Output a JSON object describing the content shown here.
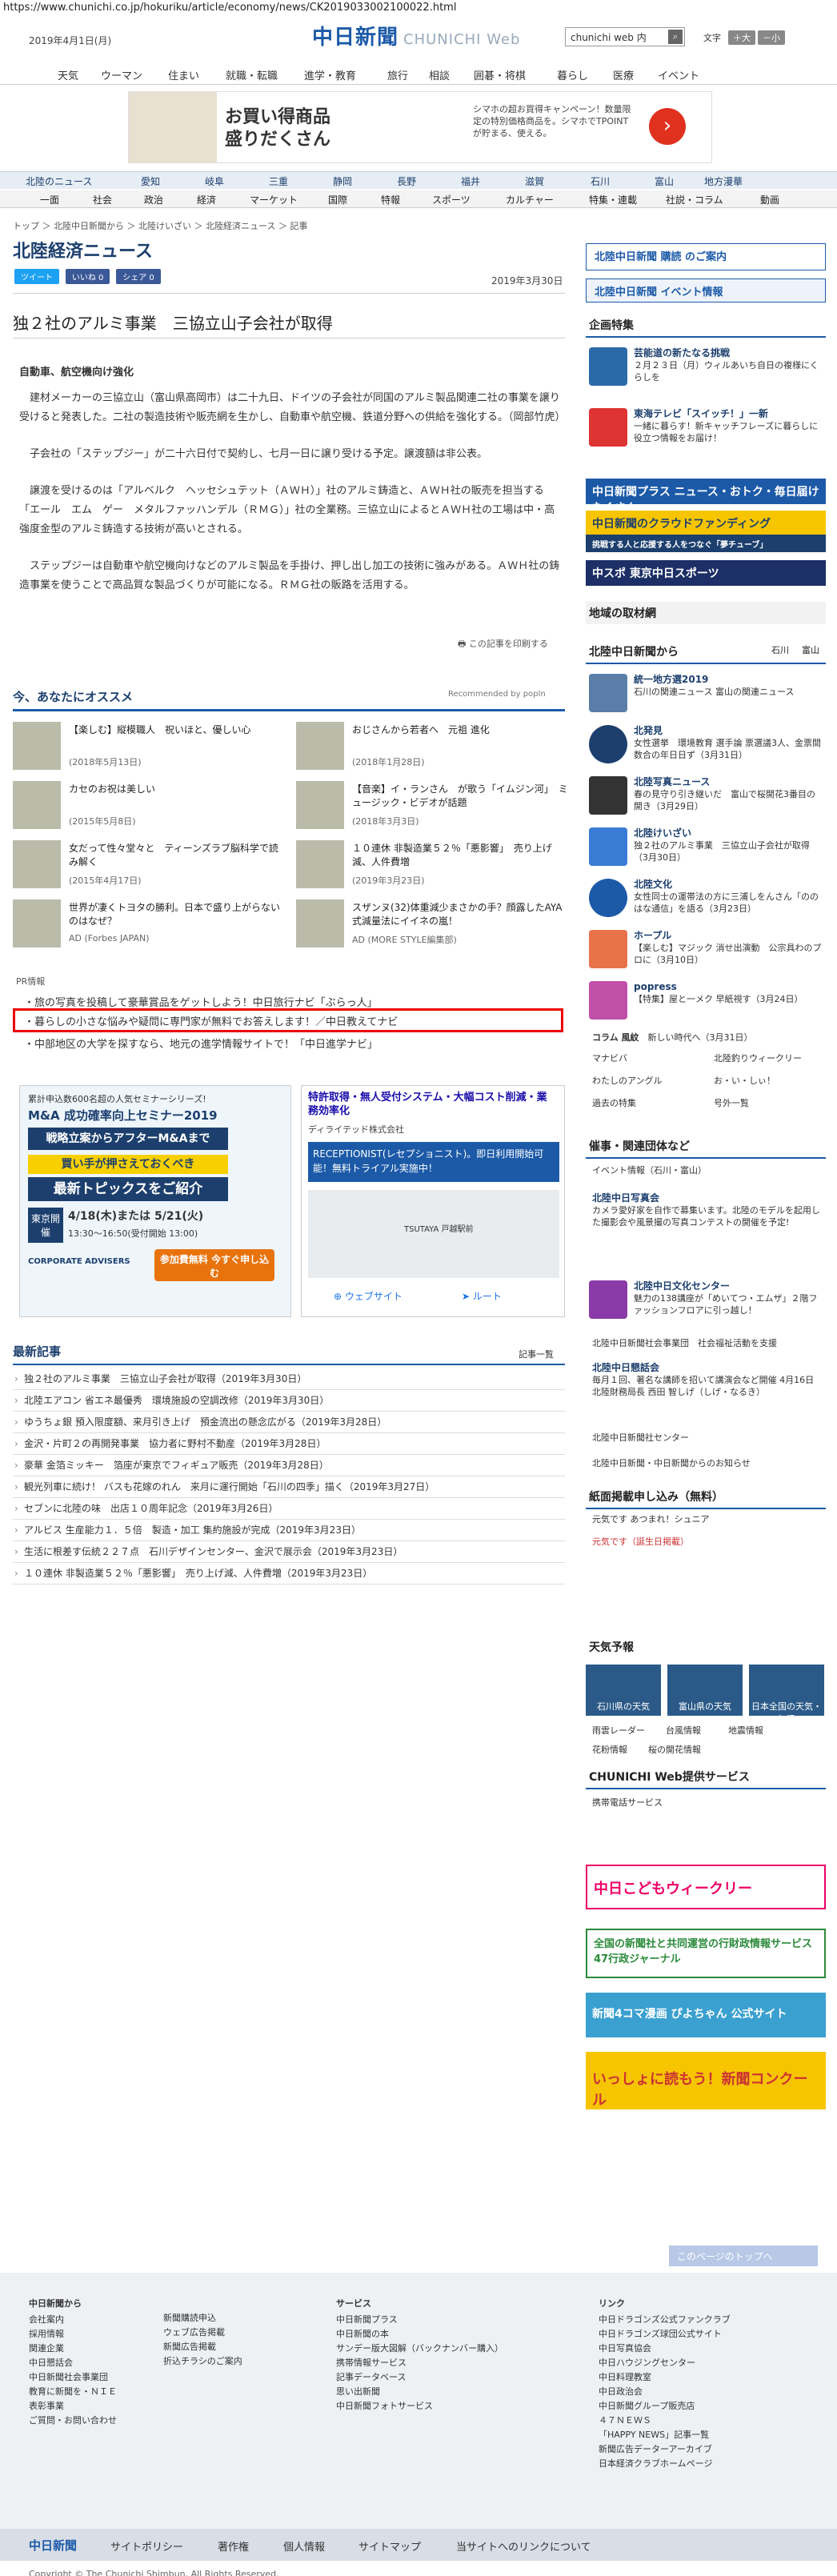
{
  "url": "https://www.chunichi.co.jp/hokuriku/article/economy/news/CK2019033002100022.html",
  "header": {
    "date": "2019年4月1日(月)",
    "logo": "中日新聞",
    "logo_web": "CHUNICHI Web",
    "search_placeholder": "chunichi web 内",
    "search_icon": "search-icon",
    "font_label": "文字",
    "font_small": "小",
    "font_plus": "＋大",
    "font_minus": "－小"
  },
  "gnav": [
    "天気",
    "ウーマン",
    "住まい",
    "就職・転職",
    "進学・教育",
    "旅行",
    "相談",
    "囲碁・将棋",
    "暮らし",
    "医療",
    "イベント"
  ],
  "banner1": {
    "title": "お買い得商品\n盛りだくさん",
    "text": "シマホの超お買得キャンペーン！数量限定の特別価格商品を。シマホでTPOINTが貯まる、使える。"
  },
  "lnav1": [
    "北陸のニュース",
    "愛知",
    "岐阜",
    "三重",
    "静岡",
    "長野",
    "福井",
    "滋賀",
    "石川",
    "富山",
    "地方漫華"
  ],
  "lnav2": [
    "一面",
    "社会",
    "政治",
    "経済",
    "マーケット",
    "国際",
    "特報",
    "スポーツ",
    "カルチャー",
    "特集・連載",
    "社説・コラム",
    "動画"
  ],
  "breadcrumb": "トップ ＞ 北陸中日新聞から ＞ 北陸けいざい ＞ 北陸経済ニュース ＞ 記事",
  "section_title": "北陸経済ニュース",
  "social": {
    "tweet": "ツイート",
    "like": "いいね 0",
    "share": "シェア 0"
  },
  "article": {
    "date": "2019年3月30日",
    "title": "独２社のアルミ事業　三協立山子会社が取得",
    "subhead": "自動車、航空機向け強化",
    "p1": "建材メーカーの三協立山（富山県高岡市）は二十九日、ドイツの子会社が同国のアルミ製品関連二社の事業を譲り受けると発表した。二社の製造技術や販売網を生かし、自動車や航空機、鉄道分野への供給を強化する。（岡部竹虎）",
    "p2": "子会社の「ステップジー」が二十六日付で契約し、七月一日に譲り受ける予定。譲渡額は非公表。",
    "p3": "譲渡を受けるのは「アルベルク　ヘッセシュテット（ＡＷＨ）」社のアルミ鋳造と、ＡＷＨ社の販売を担当する「エール　エム　ゲー　メタルファッハンデル（ＲＭＧ）」社の全業務。三協立山によるとＡＷＨ社の工場は中・高強度金型のアルミ鋳造する技術が高いとされる。",
    "p4": "ステップジーは自動車や航空機向けなどのアルミ製品を手掛け、押し出し加工の技術に強みがある。ＡＷＨ社の鋳造事業を使うことで高品質な製品づくりが可能になる。ＲＭＧ社の販路を活用する。",
    "mail": "この記事を印刷する"
  },
  "rec": {
    "title": "今、あなたにオススメ",
    "powered": "Recommended by popIn",
    "items": [
      {
        "t": "【楽しむ】縦模職人　祝いほと、優しい心",
        "d": "(2018年5月13日)"
      },
      {
        "t": "おじさんから若者へ　元祖 進化",
        "d": "(2018年1月28日)"
      },
      {
        "t": "カセのお祝は美しい",
        "d": "(2015年5月8日)"
      },
      {
        "t": "【音楽】イ・ランさん　が歌う「イムジン河」　ミュージック・ビデオが話題",
        "d": "(2018年3月3日)"
      },
      {
        "t": "女だって性々堂々と　ティーンズラブ脳科学で読み解く",
        "d": "(2015年4月17日)"
      },
      {
        "t": "１０連休 非製造業５２％「悪影響」　売り上げ減、人件費増",
        "d": "(2019年3月23日)"
      },
      {
        "t": "世界が凄くトヨタの勝利。日本で盛り上がらないのはなぜ？",
        "d": "AD (Forbes JAPAN)"
      },
      {
        "t": "スザンヌ(32)体重減少まさかの手？顔露したAYA式減量法にイイネの嵐！",
        "d": "AD (MORE STYLE編集部)"
      }
    ]
  },
  "pr": {
    "label": "PR情報",
    "links": [
      "旅の写真を投稿して豪華賞品をゲットしよう！中日旅行ナビ「ぶらっ人」",
      "暮らしの小さな悩みや疑問に専門家が無料でお答えします！／中日教えてナビ",
      "中部地区の大学を探すなら、地元の進学情報サイトで！「中日進学ナビ」"
    ]
  },
  "ad1": {
    "top": "累計申込数600名超の人気セミナーシリーズ!",
    "name": "M&A 成功確率向上セミナー2019",
    "line1": "戦略立案からアフターM&Aまで",
    "line2": "買い手が押さえておくべき",
    "line3": "最新トピックスをご紹介",
    "city": "東京開催",
    "date": "4/18(木)または 5/21(火)",
    "time": "13:30～16:50(受付開始 13:00)",
    "btn": "参加費無料 今すぐ申し込む",
    "brand": "CORPORATE ADVISERS"
  },
  "ad2": {
    "title": "特許取得・無人受付システム・大幅コスト削減・業務効率化",
    "company": "ディライテッド株式会社",
    "body": "RECEPTIONIST(レセプショニスト)。即日利用開始可能！無料トライアル実施中！",
    "web": "ウェブサイト",
    "route": "ルート",
    "map": "TSUTAYA 戸越駅前"
  },
  "latest": {
    "title": "最新記事",
    "more": "記事一覧",
    "items": [
      "独２社のアルミ事業　三協立山子会社が取得（2019年3月30日）",
      "北陸エアコン 省エネ最優秀　環境施設の空調改修（2019年3月30日）",
      "ゆうちょ銀 預入限度額、来月引き上げ　預金流出の懸念広がる（2019年3月28日）",
      "金沢・片町２の再開発事業　協力者に野村不動産（2019年3月28日）",
      "豪華 金箔ミッキー　箔座が東京でフィギュア販売（2019年3月28日）",
      "観光列車に続け！ バスも花嫁のれん　来月に運行開始「石川の四季」描く（2019年3月27日）",
      "セブンに北陸の味　出店１０周年記念（2019年3月26日）",
      "アルビス 生産能力１．５倍　製造・加工 集約施設が完成（2019年3月23日）",
      "生活に根差す伝統２２７点　石川デザインセンター、金沢で展示会（2019年3月23日）",
      "１０連休 非製造業５２％「悪影響」　売り上げ減、人件費増（2019年3月23日）"
    ]
  },
  "right": {
    "subscribe": "北陸中日新聞 購読 のご案内",
    "event": "北陸中日新聞 イベント情報",
    "kikaku": "企画特集",
    "k1": {
      "title": "芸能道の新たなる挑戦",
      "text": "２月２３日（月）ウィルあいち自日の複様にくらしを"
    },
    "k2": {
      "title": "東海テレビ「スイッチ！」一新",
      "text": "一緒に暮らす！新キャッチフレーズに暮らしに役立つ情報をお届け！"
    },
    "plus": "中日新聞プラス ニュース・おトク・毎日届けたくさん",
    "crowd": "中日新聞のクラウドファンディング",
    "crowd_sub": "挑戦する人と応援する人をつなぐ「夢チューブ」",
    "chuspo": "中スポ 東京中日スポーツ",
    "chiiki": "地域の取材網",
    "hokuriku": "北陸中日新聞から",
    "ishikawa": "石川",
    "toyama": "富山",
    "items": [
      {
        "title": "統一地方選2019",
        "text": "石川の関連ニュース 富山の関連ニュース"
      },
      {
        "title": "北発見",
        "text": "女性選挙　環境教育 選手論 票選議3人、金票間数合の年日日ず（3月31日）"
      },
      {
        "title": "北陸写真ニュース",
        "text": "春の見守り引き継いだ　富山で桜開花3番目の開き（3月29日）"
      },
      {
        "title": "北陸けいざい",
        "text": "独２社のアルミ事業　三協立山子会社が取得（3月30日）"
      },
      {
        "title": "北陸文化",
        "text": "女性同士の運帯法の方に三浦しをんさん「ののはな通信」を語る（3月23日）"
      },
      {
        "title": "ホープル",
        "text": "【楽しむ】マジック 消せ出演動　公宗具わのプロに（3月10日）"
      },
      {
        "title": "popress",
        "text": "【特集】屋と一メク 早紙視す（3月24日）"
      }
    ],
    "column": "コラム 風紋",
    "column_text": "新しい時代へ（3月31日）",
    "links": [
      "マナビバ",
      "北陸釣りウィークリー",
      "わたしのアングル",
      "お・い・しぃ！",
      "過去の特集",
      "号外一覧"
    ],
    "jiken": "催事・関連団体など",
    "event_info": "イベント情報（石川・富山）",
    "j1": {
      "title": "北陸中日写真会",
      "text": "カメラ愛好家を自作で募集います。北陸のモデルを起用した撮影会や風景撮の写真コンテストの開催を予定!"
    },
    "j2": {
      "title": "北陸中日文化センター",
      "text": "魅力の138講座が「めいてつ・エムザ」２階ファッションフロアに引っ越し！"
    },
    "j3": "北陸中日新聞社会事業団　社会福祉活動を支援",
    "j4": {
      "title": "北陸中日懇話会",
      "text": "毎月１回、著名な講師を招いて講演会など開催 4月16日 北陸財務局長 西田 智しげ（しげ・なるき）"
    },
    "j5": "北陸中日新聞社センター",
    "j6": "北陸中日新聞・中日新聞からのお知らせ",
    "shimen": "紙面掲載申し込み（無料）",
    "shimen1": "元気です あつまれ！シュニア",
    "shimen2": "元気です（誕生日掲載）",
    "tenki": "天気予報",
    "w1": "石川県の天気",
    "w2": "富山県の天気",
    "w3": "日本全国の天気・気温",
    "wlinks": [
      "雨雲レーダー",
      "台風情報",
      "地震情報",
      "花粉情報",
      "桜の開花情報"
    ],
    "service": "CHUNICHI Web提供サービス",
    "service1": "携帯電話サービス",
    "b1": "中日こどもウィークリー",
    "b2": "全国の新聞社と共同運営の行財政情報サービス 47行政ジャーナル",
    "b3": "新聞4コマ漫画 ぴよちゃん 公式サイト",
    "b4": "いっしょに読もう！新聞コンクール"
  },
  "pagetop": "このページのトップへ",
  "footer": {
    "c1": [
      "中日新聞から",
      "会社案内",
      "採用情報",
      "関連企業",
      "中日懇話会",
      "中日新聞社会事業団",
      "教育に新聞を・ＮＩＥ",
      "表彰事業",
      "ご質問・お問い合わせ"
    ],
    "c2": [
      "新聞購読申込",
      "ウェブ広告掲載",
      "新聞広告掲載",
      "折込チラシのご案内"
    ],
    "c3": [
      "サービス",
      "中日新聞プラス",
      "中日新聞の本",
      "サンデー版大図解（バックナンバー購入）",
      "携帯情報サービス",
      "記事データベース",
      "思い出新聞",
      "中日新聞フォトサービス"
    ],
    "c4": [
      "リンク",
      "中日ドラゴンズ公式ファンクラブ",
      "中日ドラゴンズ球団公式サイト",
      "中日写真協会",
      "中日ハウジングセンター",
      "中日料理教室",
      "中日政治会",
      "中日新聞グループ販売店",
      "４７ＮＥＷＳ",
      "「HAPPY NEWS」記事一覧",
      "新聞広告データーアーカイブ",
      "日本経済クラブホームページ"
    ],
    "bar": [
      "中日新聞",
      "サイトポリシー",
      "著作権",
      "個人情報",
      "サイトマップ",
      "当サイトへのリンクについて"
    ],
    "copy": "Copyright © The Chunichi Shimbun, All Rights Reserved."
  }
}
